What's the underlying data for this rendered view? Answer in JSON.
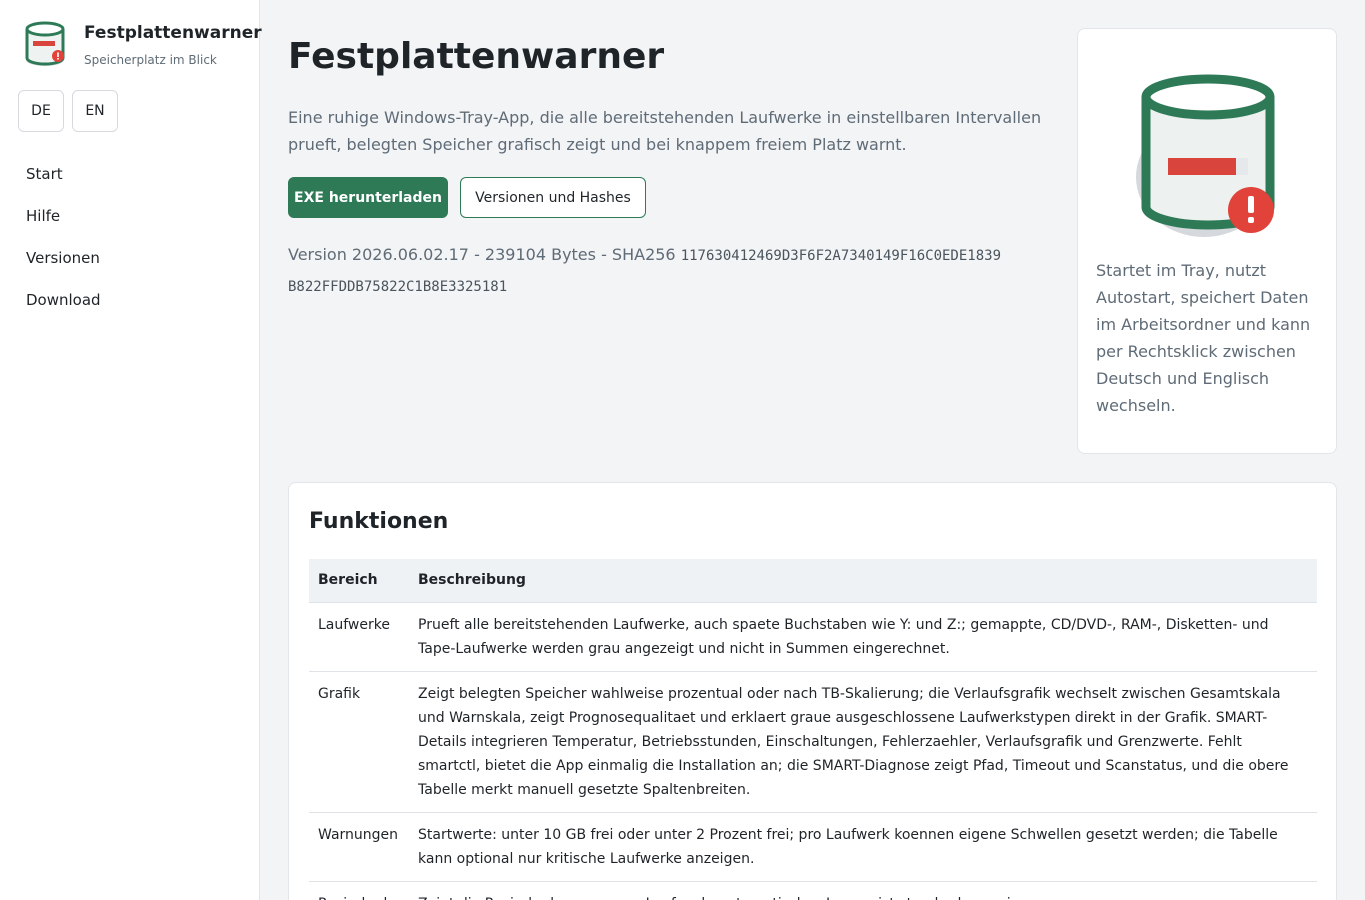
{
  "brand": {
    "title": "Festplattenwarner",
    "subtitle": "Speicherplatz im Blick",
    "logo_icon": "disk-warning-icon"
  },
  "languages": [
    "DE",
    "EN"
  ],
  "nav": [
    {
      "label": "Start"
    },
    {
      "label": "Hilfe"
    },
    {
      "label": "Versionen"
    },
    {
      "label": "Download"
    }
  ],
  "hero": {
    "title": "Festplattenwarner",
    "description": "Eine ruhige Windows-Tray-App, die alle bereitstehenden Laufwerke in einstellbaren Intervallen prueft, belegten Speicher grafisch zeigt und bei knappem freiem Platz warnt.",
    "download_label": "EXE herunterladen",
    "versions_label": "Versionen und Hashes",
    "version_text": "Version 2026.06.02.17 - 239104 Bytes - SHA256",
    "hash": "117630412469D3F6F2A7340149F16C0EDE1839B822FFDDB75822C1B8E3325181"
  },
  "info_card": {
    "icon": "disk-warning-icon",
    "text": "Startet im Tray, nutzt Autostart, speichert Daten im Arbeitsordner und kann per Rechtsklick zwischen Deutsch und Englisch wechseln."
  },
  "features": {
    "heading": "Funktionen",
    "columns": [
      "Bereich",
      "Beschreibung"
    ],
    "rows": [
      {
        "area": "Laufwerke",
        "desc": "Prueft alle bereitstehenden Laufwerke, auch spaete Buchstaben wie Y: und Z:; gemappte, CD/DVD-, RAM-, Disketten- und Tape-Laufwerke werden grau angezeigt und nicht in Summen eingerechnet."
      },
      {
        "area": "Grafik",
        "desc": "Zeigt belegten Speicher wahlweise prozentual oder nach TB-Skalierung; die Verlaufsgrafik wechselt zwischen Gesamtskala und Warnskala, zeigt Prognosequalitaet und erklaert graue ausgeschlossene Laufwerkstypen direkt in der Grafik. SMART-Details integrieren Temperatur, Betriebsstunden, Einschaltungen, Fehlerzaehler, Verlaufsgrafik und Grenzwerte. Fehlt smartctl, bietet die App einmalig die Installation an; die SMART-Diagnose zeigt Pfad, Timeout und Scanstatus, und die obere Tabelle merkt manuell gesetzte Spaltenbreiten."
      },
      {
        "area": "Warnungen",
        "desc": "Startwerte: unter 10 GB frei oder unter 2 Prozent frei; pro Laufwerk koennen eigene Schwellen gesetzt werden; die Tabelle kann optional nur kritische Laufwerke anzeigen."
      },
      {
        "area": "Papierkorb",
        "desc": "Zeigt die Papierkorbgroesse pro Laufwerk; automatisches Leeren ist standardmaessig aus."
      }
    ]
  },
  "colors": {
    "accent": "#2e7a57",
    "warning": "#e1423a",
    "bar": "#d9443c"
  }
}
